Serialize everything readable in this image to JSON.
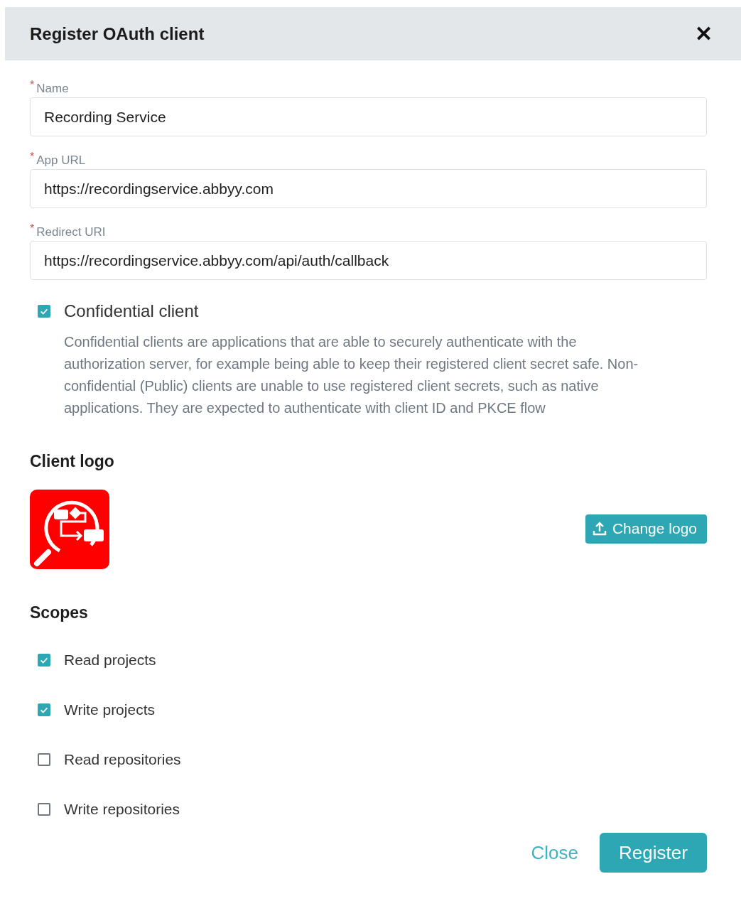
{
  "dialog": {
    "title": "Register OAuth client",
    "close_icon": "✕"
  },
  "fields": [
    {
      "label": "Name",
      "required_mark": "*",
      "value": "Recording Service"
    },
    {
      "label": "App URL",
      "required_mark": "*",
      "value": "https://recordingservice.abbyy.com"
    },
    {
      "label": "Redirect URI",
      "required_mark": "*",
      "value": "https://recordingservice.abbyy.com/api/auth/callback"
    }
  ],
  "confidential": {
    "label": "Confidential client",
    "checked": true,
    "description": "Confidential clients are applications that are able to securely authenticate with the authorization server, for example being able to keep their registered client secret safe. Non-confidential (Public) clients are unable to use registered client secrets, such as native applications. They are expected to authenticate with client ID and PKCE flow"
  },
  "client_logo": {
    "heading": "Client logo",
    "button": "Change logo"
  },
  "scopes": {
    "heading": "Scopes",
    "items": [
      {
        "label": "Read projects",
        "checked": true
      },
      {
        "label": "Write projects",
        "checked": true
      },
      {
        "label": "Read repositories",
        "checked": false
      },
      {
        "label": "Write repositories",
        "checked": false
      }
    ]
  },
  "buttons": [
    {
      "label": "Close",
      "kind": "link"
    },
    {
      "label": "Register",
      "kind": "primary"
    }
  ]
}
